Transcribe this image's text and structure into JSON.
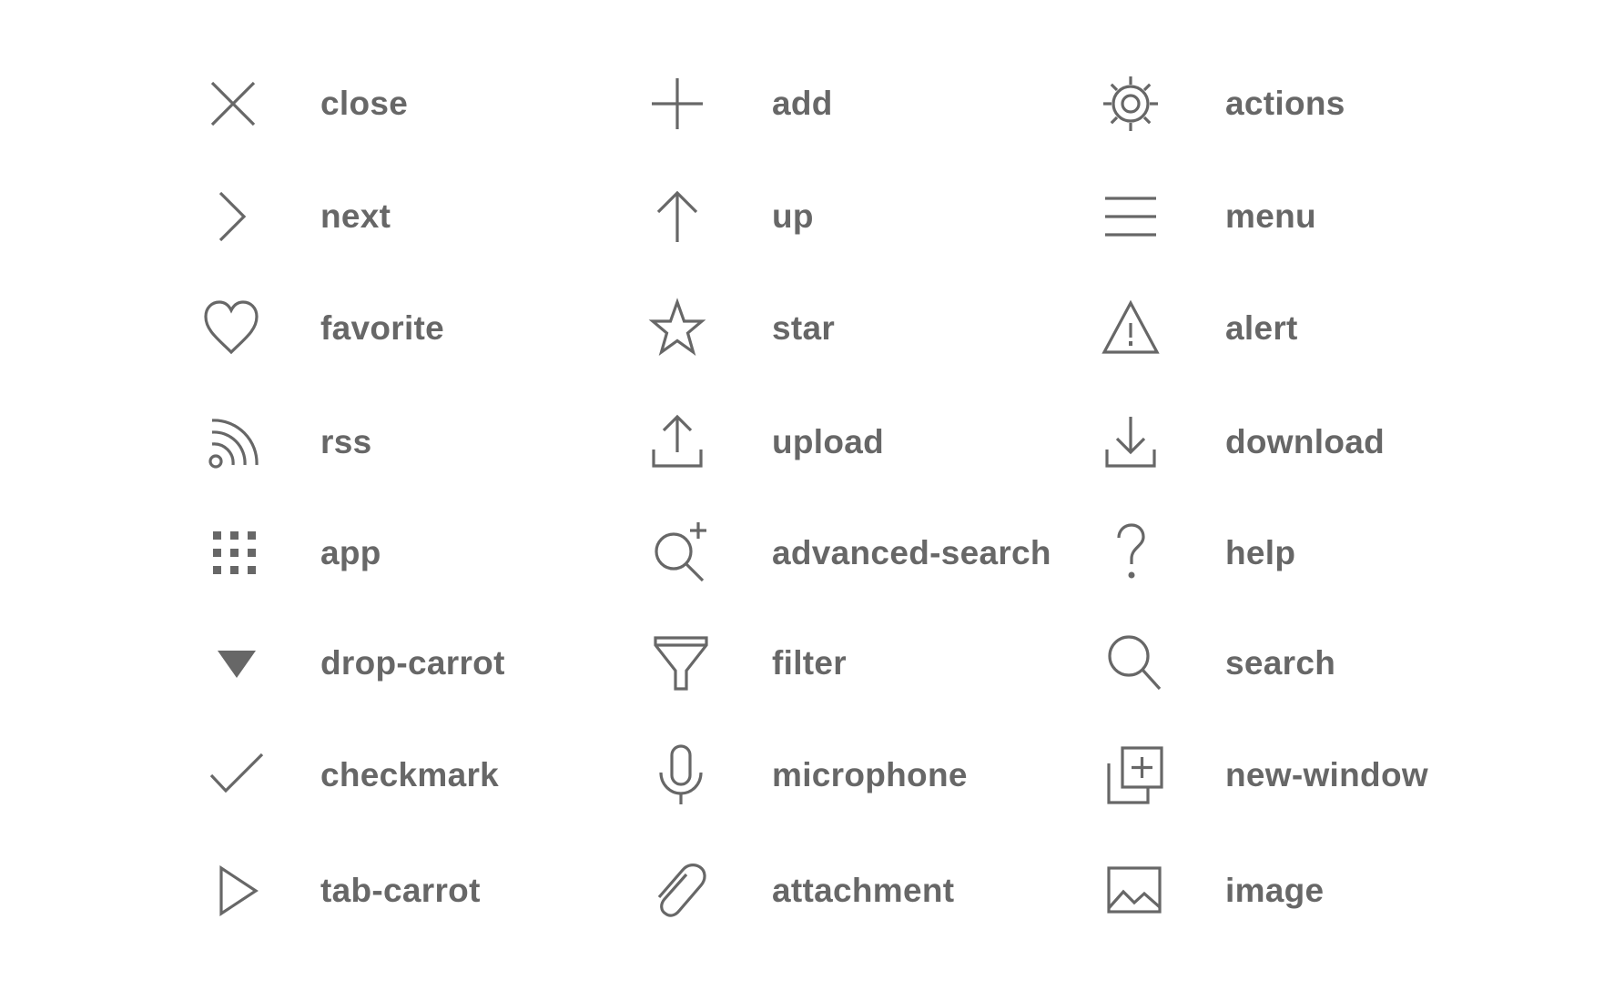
{
  "icons": [
    {
      "id": "close",
      "label": "close",
      "icon": "close-icon"
    },
    {
      "id": "add",
      "label": "add",
      "icon": "add-icon"
    },
    {
      "id": "actions",
      "label": "actions",
      "icon": "gear-icon"
    },
    {
      "id": "next",
      "label": "next",
      "icon": "chevron-right-icon"
    },
    {
      "id": "up",
      "label": "up",
      "icon": "arrow-up-icon"
    },
    {
      "id": "menu",
      "label": "menu",
      "icon": "menu-icon"
    },
    {
      "id": "favorite",
      "label": "favorite",
      "icon": "heart-icon"
    },
    {
      "id": "star",
      "label": "star",
      "icon": "star-icon"
    },
    {
      "id": "alert",
      "label": "alert",
      "icon": "alert-icon"
    },
    {
      "id": "rss",
      "label": "rss",
      "icon": "rss-icon"
    },
    {
      "id": "upload",
      "label": "upload",
      "icon": "upload-icon"
    },
    {
      "id": "download",
      "label": "download",
      "icon": "download-icon"
    },
    {
      "id": "app",
      "label": "app",
      "icon": "app-grid-icon"
    },
    {
      "id": "advanced-search",
      "label": "advanced-search",
      "icon": "advanced-search-icon"
    },
    {
      "id": "help",
      "label": "help",
      "icon": "question-mark-icon"
    },
    {
      "id": "drop-carrot",
      "label": "drop-carrot",
      "icon": "triangle-down-icon"
    },
    {
      "id": "filter",
      "label": "filter",
      "icon": "funnel-icon"
    },
    {
      "id": "search",
      "label": "search",
      "icon": "search-icon"
    },
    {
      "id": "checkmark",
      "label": "checkmark",
      "icon": "checkmark-icon"
    },
    {
      "id": "microphone",
      "label": "microphone",
      "icon": "microphone-icon"
    },
    {
      "id": "new-window",
      "label": "new-window",
      "icon": "new-window-icon"
    },
    {
      "id": "tab-carrot",
      "label": "tab-carrot",
      "icon": "triangle-right-icon"
    },
    {
      "id": "attachment",
      "label": "attachment",
      "icon": "paperclip-icon"
    },
    {
      "id": "image",
      "label": "image",
      "icon": "image-icon"
    }
  ],
  "colors": {
    "ink": "#676767",
    "background": "#ffffff"
  }
}
